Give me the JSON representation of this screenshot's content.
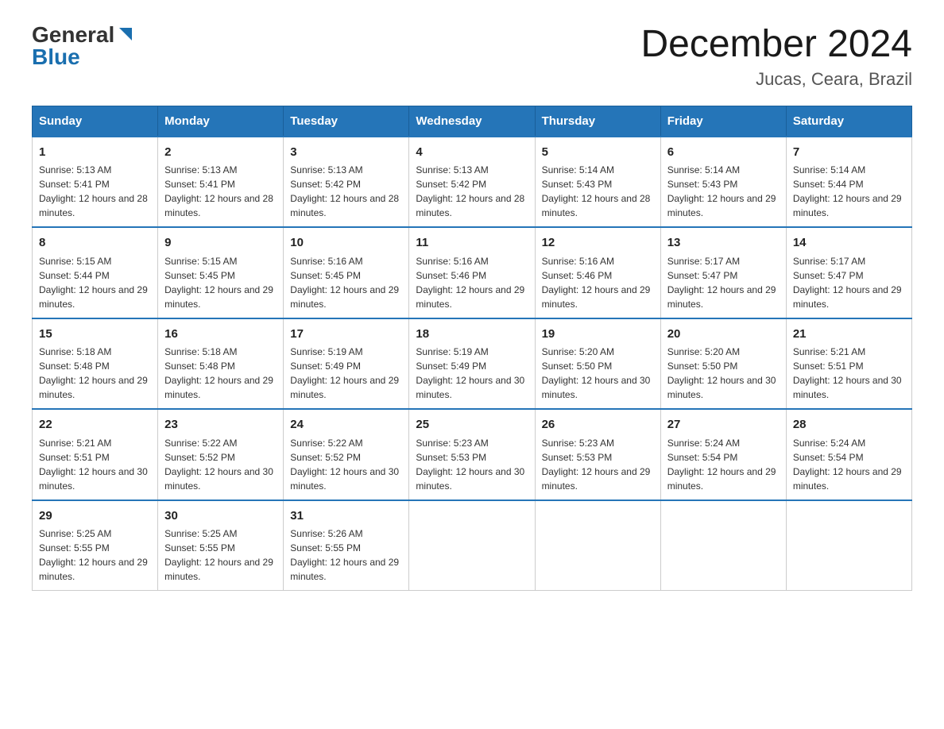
{
  "logo": {
    "general": "General",
    "blue": "Blue",
    "triangle": "▶"
  },
  "title": "December 2024",
  "location": "Jucas, Ceara, Brazil",
  "columns": [
    "Sunday",
    "Monday",
    "Tuesday",
    "Wednesday",
    "Thursday",
    "Friday",
    "Saturday"
  ],
  "weeks": [
    [
      {
        "day": "1",
        "sunrise": "5:13 AM",
        "sunset": "5:41 PM",
        "daylight": "12 hours and 28 minutes."
      },
      {
        "day": "2",
        "sunrise": "5:13 AM",
        "sunset": "5:41 PM",
        "daylight": "12 hours and 28 minutes."
      },
      {
        "day": "3",
        "sunrise": "5:13 AM",
        "sunset": "5:42 PM",
        "daylight": "12 hours and 28 minutes."
      },
      {
        "day": "4",
        "sunrise": "5:13 AM",
        "sunset": "5:42 PM",
        "daylight": "12 hours and 28 minutes."
      },
      {
        "day": "5",
        "sunrise": "5:14 AM",
        "sunset": "5:43 PM",
        "daylight": "12 hours and 28 minutes."
      },
      {
        "day": "6",
        "sunrise": "5:14 AM",
        "sunset": "5:43 PM",
        "daylight": "12 hours and 29 minutes."
      },
      {
        "day": "7",
        "sunrise": "5:14 AM",
        "sunset": "5:44 PM",
        "daylight": "12 hours and 29 minutes."
      }
    ],
    [
      {
        "day": "8",
        "sunrise": "5:15 AM",
        "sunset": "5:44 PM",
        "daylight": "12 hours and 29 minutes."
      },
      {
        "day": "9",
        "sunrise": "5:15 AM",
        "sunset": "5:45 PM",
        "daylight": "12 hours and 29 minutes."
      },
      {
        "day": "10",
        "sunrise": "5:16 AM",
        "sunset": "5:45 PM",
        "daylight": "12 hours and 29 minutes."
      },
      {
        "day": "11",
        "sunrise": "5:16 AM",
        "sunset": "5:46 PM",
        "daylight": "12 hours and 29 minutes."
      },
      {
        "day": "12",
        "sunrise": "5:16 AM",
        "sunset": "5:46 PM",
        "daylight": "12 hours and 29 minutes."
      },
      {
        "day": "13",
        "sunrise": "5:17 AM",
        "sunset": "5:47 PM",
        "daylight": "12 hours and 29 minutes."
      },
      {
        "day": "14",
        "sunrise": "5:17 AM",
        "sunset": "5:47 PM",
        "daylight": "12 hours and 29 minutes."
      }
    ],
    [
      {
        "day": "15",
        "sunrise": "5:18 AM",
        "sunset": "5:48 PM",
        "daylight": "12 hours and 29 minutes."
      },
      {
        "day": "16",
        "sunrise": "5:18 AM",
        "sunset": "5:48 PM",
        "daylight": "12 hours and 29 minutes."
      },
      {
        "day": "17",
        "sunrise": "5:19 AM",
        "sunset": "5:49 PM",
        "daylight": "12 hours and 29 minutes."
      },
      {
        "day": "18",
        "sunrise": "5:19 AM",
        "sunset": "5:49 PM",
        "daylight": "12 hours and 30 minutes."
      },
      {
        "day": "19",
        "sunrise": "5:20 AM",
        "sunset": "5:50 PM",
        "daylight": "12 hours and 30 minutes."
      },
      {
        "day": "20",
        "sunrise": "5:20 AM",
        "sunset": "5:50 PM",
        "daylight": "12 hours and 30 minutes."
      },
      {
        "day": "21",
        "sunrise": "5:21 AM",
        "sunset": "5:51 PM",
        "daylight": "12 hours and 30 minutes."
      }
    ],
    [
      {
        "day": "22",
        "sunrise": "5:21 AM",
        "sunset": "5:51 PM",
        "daylight": "12 hours and 30 minutes."
      },
      {
        "day": "23",
        "sunrise": "5:22 AM",
        "sunset": "5:52 PM",
        "daylight": "12 hours and 30 minutes."
      },
      {
        "day": "24",
        "sunrise": "5:22 AM",
        "sunset": "5:52 PM",
        "daylight": "12 hours and 30 minutes."
      },
      {
        "day": "25",
        "sunrise": "5:23 AM",
        "sunset": "5:53 PM",
        "daylight": "12 hours and 30 minutes."
      },
      {
        "day": "26",
        "sunrise": "5:23 AM",
        "sunset": "5:53 PM",
        "daylight": "12 hours and 29 minutes."
      },
      {
        "day": "27",
        "sunrise": "5:24 AM",
        "sunset": "5:54 PM",
        "daylight": "12 hours and 29 minutes."
      },
      {
        "day": "28",
        "sunrise": "5:24 AM",
        "sunset": "5:54 PM",
        "daylight": "12 hours and 29 minutes."
      }
    ],
    [
      {
        "day": "29",
        "sunrise": "5:25 AM",
        "sunset": "5:55 PM",
        "daylight": "12 hours and 29 minutes."
      },
      {
        "day": "30",
        "sunrise": "5:25 AM",
        "sunset": "5:55 PM",
        "daylight": "12 hours and 29 minutes."
      },
      {
        "day": "31",
        "sunrise": "5:26 AM",
        "sunset": "5:55 PM",
        "daylight": "12 hours and 29 minutes."
      },
      null,
      null,
      null,
      null
    ]
  ]
}
